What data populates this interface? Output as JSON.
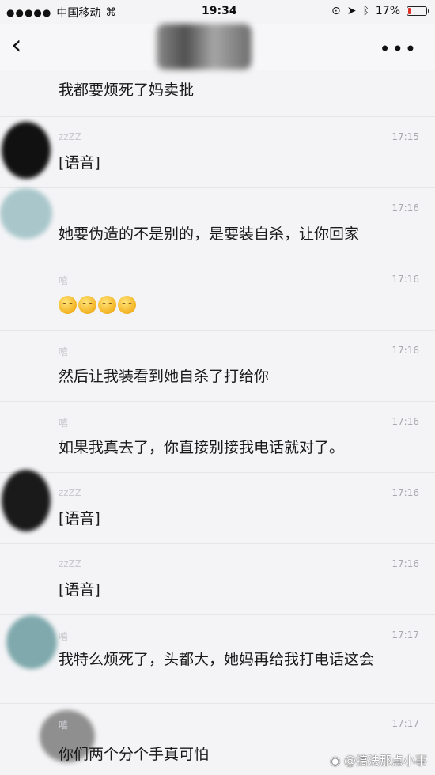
{
  "status_bar": {
    "carrier": "中国移动",
    "time": "19:34",
    "battery": "17%",
    "battery_fraction": 0.17
  },
  "header": {
    "back_icon": "chevron-left-icon",
    "more_icon": "more-icon"
  },
  "messages": [
    {
      "sender": "",
      "time": "",
      "text": "我都要烦死了妈卖批"
    },
    {
      "sender": "zzZZ",
      "time": "17:15",
      "text": "[语音]"
    },
    {
      "sender": "",
      "time": "17:16",
      "text": "她要伪造的不是别的，是要装自杀，让你回家"
    },
    {
      "sender": "嘻",
      "time": "17:16",
      "text": ""
    },
    {
      "sender": "嘻",
      "time": "17:16",
      "text": "然后让我装看到她自杀了打给你"
    },
    {
      "sender": "嘻",
      "time": "17:16",
      "text": "如果我真去了，你直接别接我电话就对了。"
    },
    {
      "sender": "zzZZ",
      "time": "17:16",
      "text": "[语音]"
    },
    {
      "sender": "zzZZ",
      "time": "17:16",
      "text": "[语音]"
    },
    {
      "sender": "嘻",
      "time": "17:17",
      "text": "我特么烦死了，头都大，她妈再给我打电话这会"
    },
    {
      "sender": "嘻",
      "time": "17:17",
      "text": "你们两个分个手真可怕"
    }
  ],
  "emojis": [
    "smile-emoji",
    "smile-emoji",
    "smile-emoji",
    "smile-emoji"
  ],
  "watermark": "@搞法那点小事"
}
